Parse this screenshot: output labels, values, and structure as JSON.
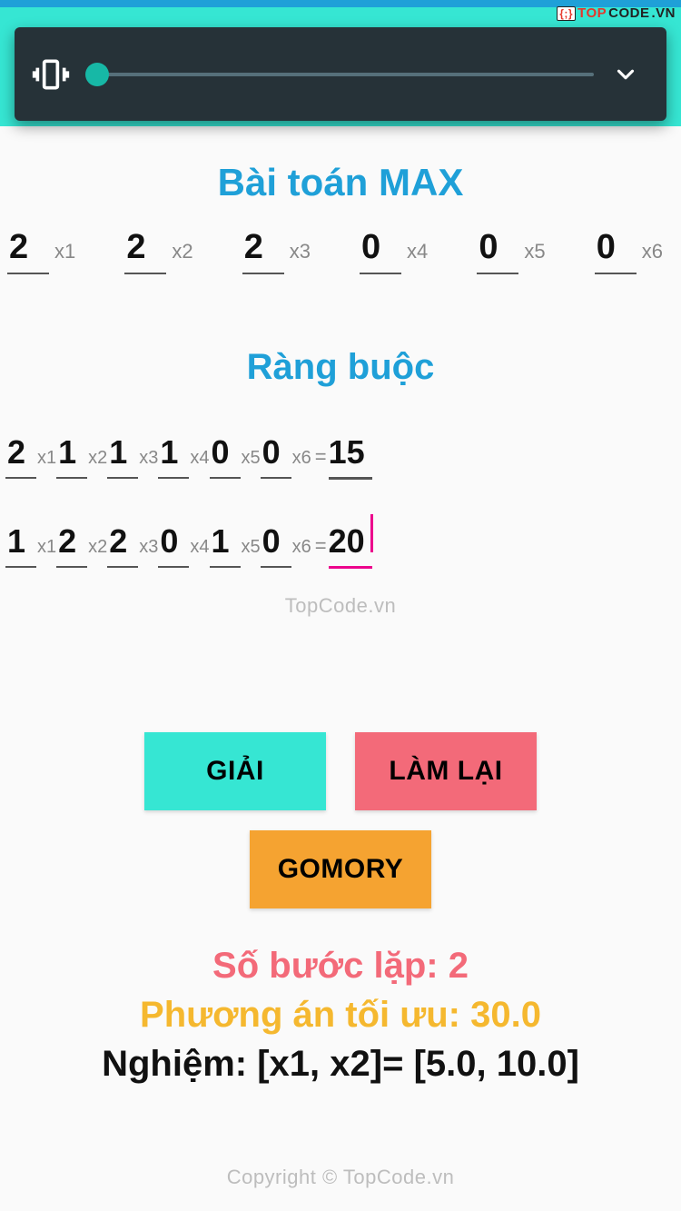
{
  "branding": {
    "top_logo_code": "{;}",
    "top_logo_top": "TOP",
    "top_logo_code2": "CODE",
    "top_logo_vn": ".VN",
    "center_watermark": "TopCode.vn",
    "bottom_watermark": "Copyright © TopCode.vn"
  },
  "overlay": {
    "slider_value": 0
  },
  "title": "Bài toán MAX",
  "objective": [
    {
      "coef": "2",
      "var": "x1"
    },
    {
      "coef": "2",
      "var": "x2"
    },
    {
      "coef": "2",
      "var": "x3"
    },
    {
      "coef": "0",
      "var": "x4"
    },
    {
      "coef": "0",
      "var": "x5"
    },
    {
      "coef": "0",
      "var": "x6"
    }
  ],
  "constraints_title": "Ràng buộc",
  "constraints": [
    {
      "coefs": [
        "2",
        "1",
        "1",
        "1",
        "0",
        "0"
      ],
      "vars": [
        "x1",
        "x2",
        "x3",
        "x4",
        "x5",
        "x6"
      ],
      "eq": "=",
      "rhs": "15",
      "active": false
    },
    {
      "coefs": [
        "1",
        "2",
        "2",
        "0",
        "1",
        "0"
      ],
      "vars": [
        "x1",
        "x2",
        "x3",
        "x4",
        "x5",
        "x6"
      ],
      "eq": "=",
      "rhs": "20",
      "active": true
    }
  ],
  "buttons": {
    "solve": "GIẢI",
    "reset": "LÀM LẠI",
    "gomory": "GOMORY"
  },
  "results": {
    "steps_label": "Số bước lặp: ",
    "steps_value": "2",
    "opt_label": "Phương án tối ưu: ",
    "opt_value": "30.0",
    "sol_prefix": "Nghiệm: ",
    "sol_vars": "[x1, x2]",
    "sol_eq": "= ",
    "sol_vals": "[5.0, 10.0]"
  }
}
